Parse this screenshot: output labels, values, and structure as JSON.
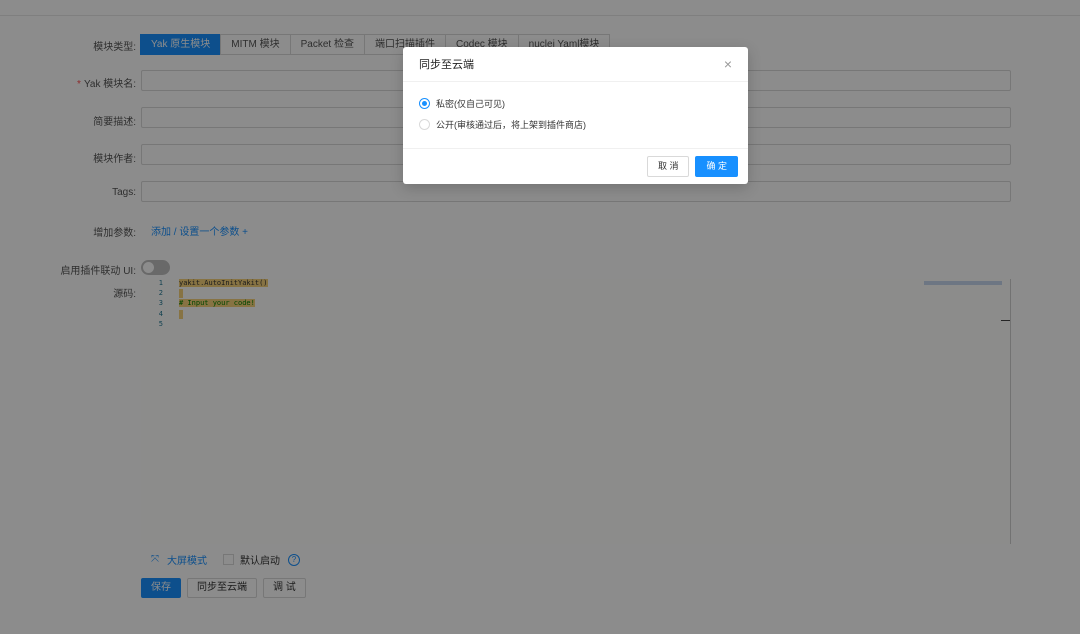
{
  "form": {
    "type_label": "模块类型:",
    "type_tabs": [
      "Yak 原生模块",
      "MITM 模块",
      "Packet 检查",
      "端口扫描插件",
      "Codec 模块",
      "nuclei Yaml模块"
    ],
    "name_label": "Yak 模块名:",
    "name_required_mark": "*",
    "desc_label": "简要描述:",
    "author_label": "模块作者:",
    "tags_label": "Tags:",
    "params_label": "增加参数:",
    "params_link": "添加 / 设置一个参数 +",
    "linkage_label": "启用插件联动 UI:",
    "source_label": "源码:"
  },
  "editor": {
    "line_numbers": [
      "1",
      "2",
      "3",
      "4",
      "5"
    ],
    "lines": [
      "yakit.AutoInitYakit()",
      "",
      "# Input your code!",
      "",
      ""
    ]
  },
  "editor_footer": {
    "fullscreen_label": "大屏模式",
    "default_enable_label": "默认启动",
    "help_icon": "?"
  },
  "actions": {
    "save": "保存",
    "sync": "同步至云端",
    "debug": "调 试"
  },
  "modal": {
    "title": "同步至云端",
    "close": "×",
    "options": [
      {
        "label": "私密(仅自己可见)",
        "selected": true
      },
      {
        "label": "公开(审核通过后，将上架到插件商店)",
        "selected": false
      }
    ],
    "cancel": "取 消",
    "ok": "确 定"
  },
  "colors": {
    "primary": "#1890ff",
    "mask": "rgba(0,0,0,0.45)"
  }
}
